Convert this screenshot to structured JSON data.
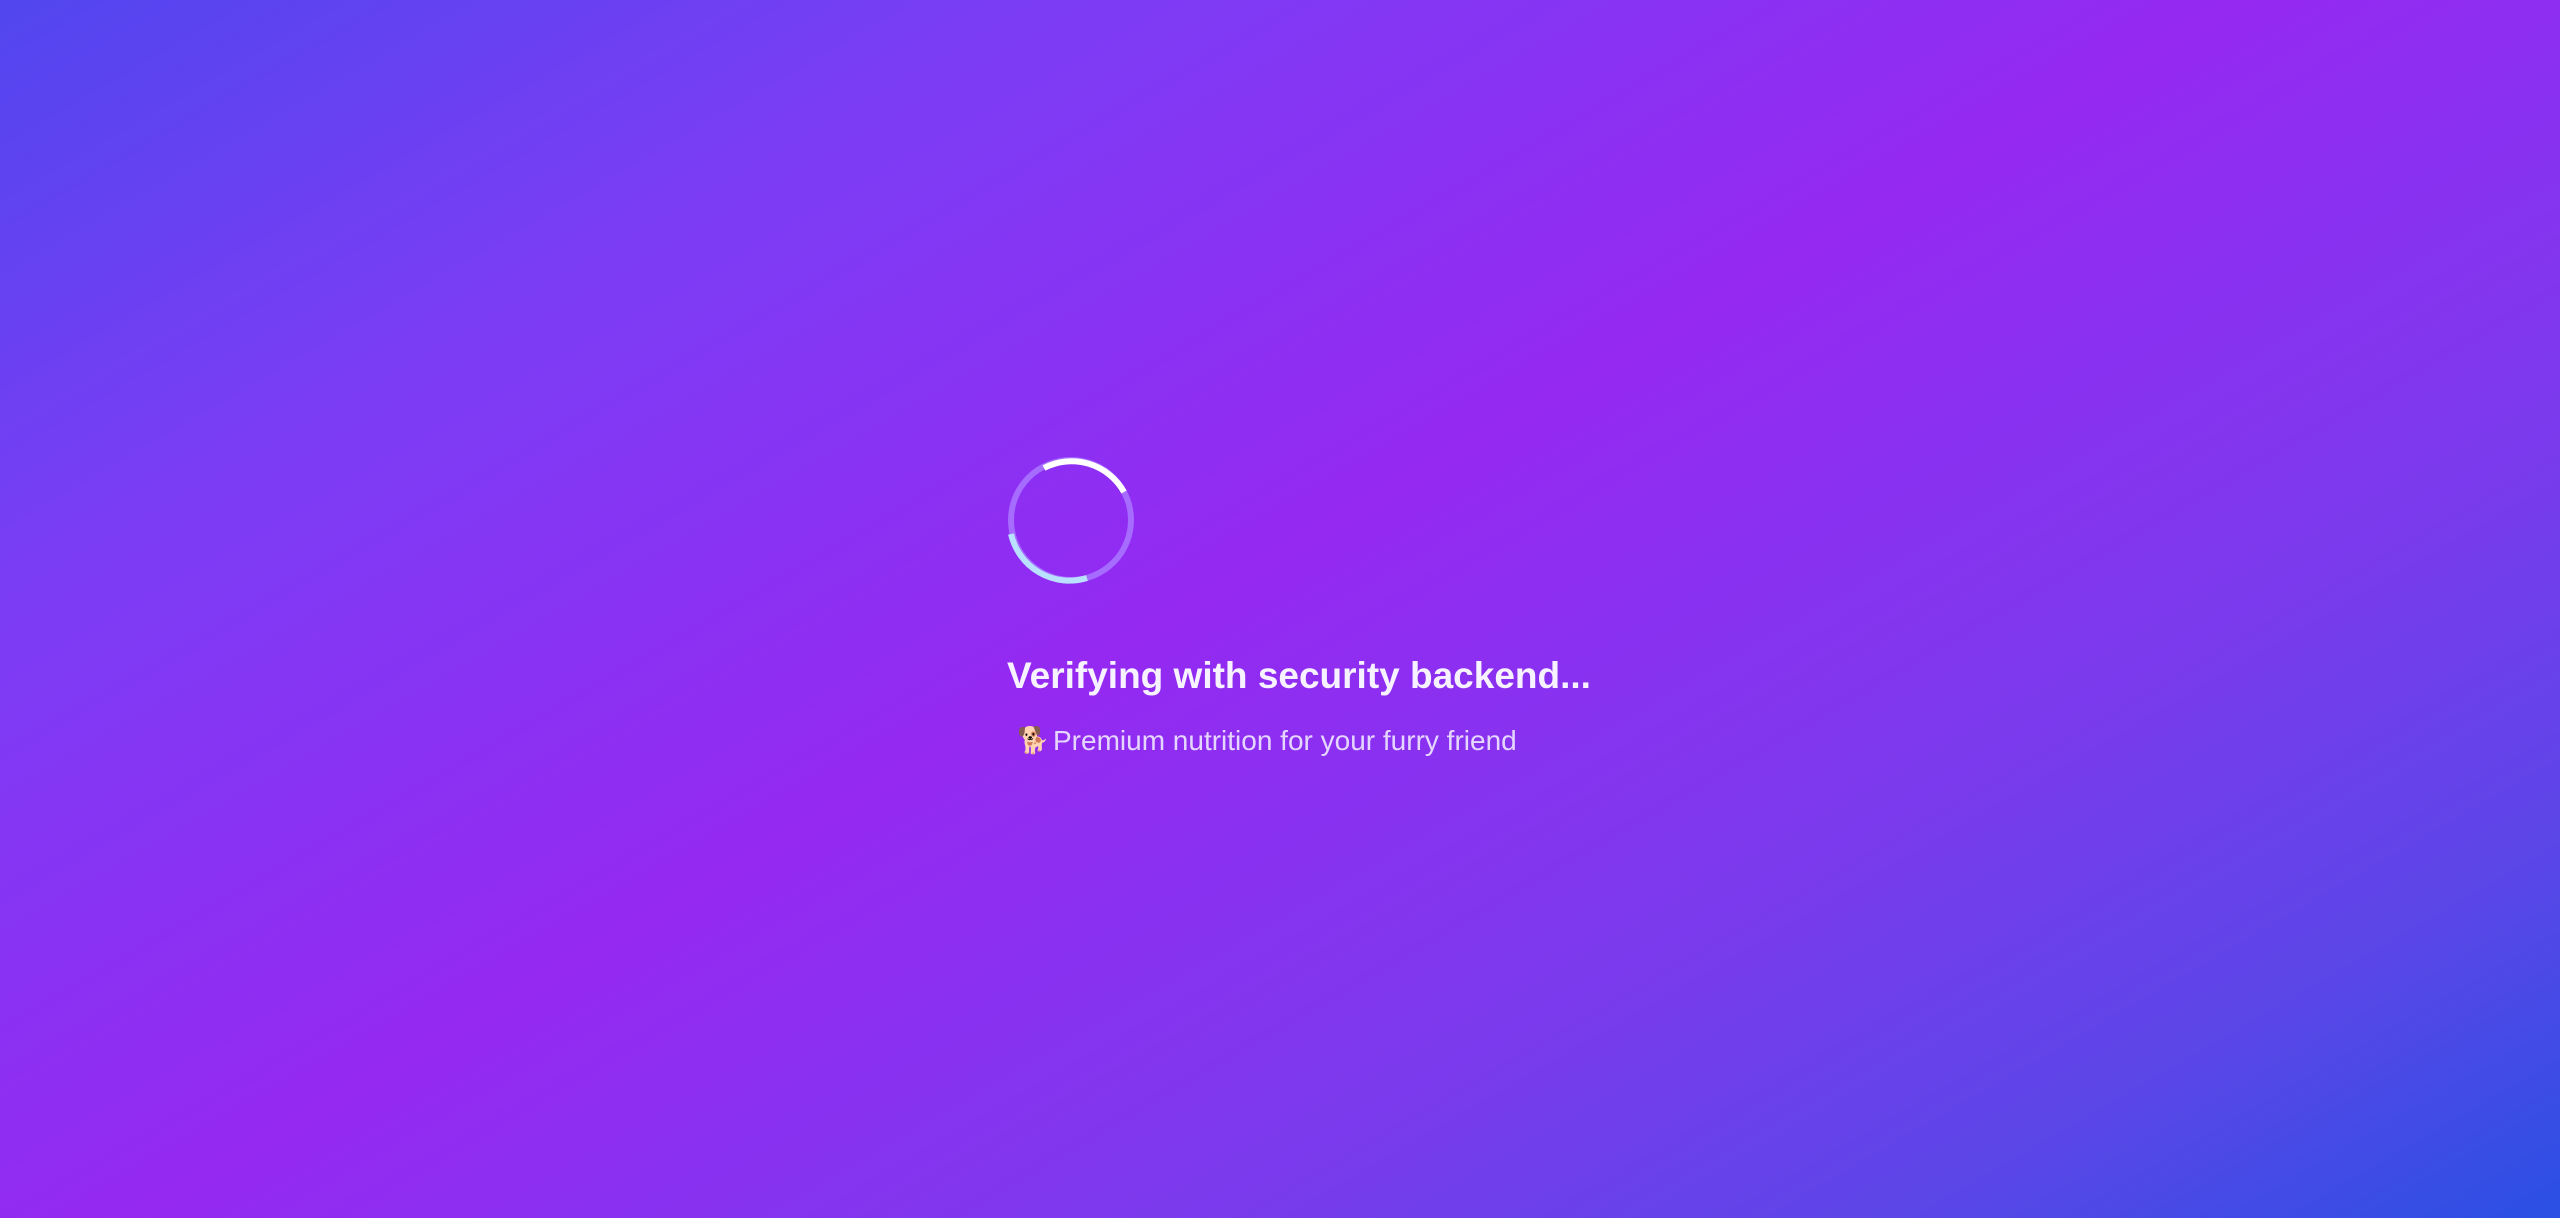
{
  "loading": {
    "status_text": "Verifying with security backend...",
    "tagline_icon": "dog-emoji",
    "tagline_glyph": "🐕",
    "tagline_text": "Premium nutrition for your furry friend"
  },
  "colors": {
    "gradient_start": "#5146ef",
    "gradient_mid": "#9529f2",
    "gradient_end": "#2a50e3",
    "spinner_track": "#a56cff",
    "spinner_arc_white": "#ffffff",
    "spinner_arc_cyan": "#b9e1ff"
  }
}
